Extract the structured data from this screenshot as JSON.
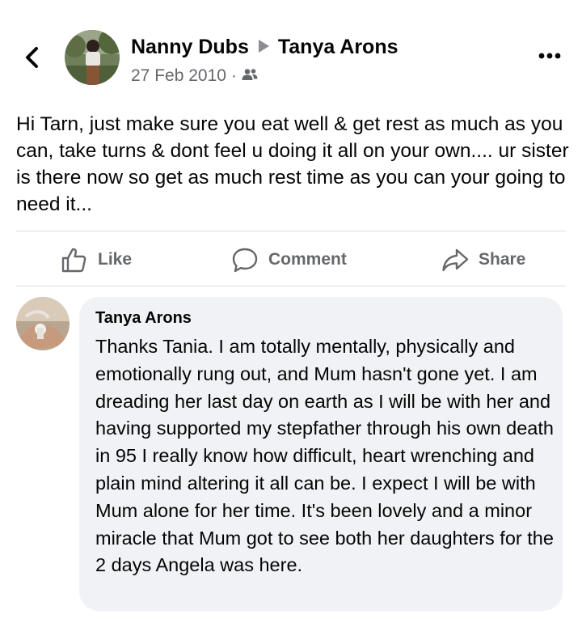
{
  "post": {
    "author": "Nanny Dubs",
    "recipient": "Tanya Arons",
    "date": "27 Feb 2010",
    "separator": "·",
    "audience_icon": "friends-icon",
    "text": "Hi Tarn, just make sure you eat well & get rest as much as you can, take turns & dont feel u doing it all on your own.... ur sister is there now so get as much rest time as you can your going to need it..."
  },
  "actions": {
    "like": "Like",
    "comment": "Comment",
    "share": "Share"
  },
  "comment": {
    "author": "Tanya Arons",
    "text": "Thanks Tania.  I am totally mentally, physically and emotionally rung out, and Mum hasn't gone yet.  I am dreading her last day on earth as I will be with her and having supported my stepfather through his own death in 95 I really know how difficult, heart wrenching and plain mind altering it all can be.  I expect I will be with Mum alone for her time.  It's been lovely and a minor miracle that Mum got to see both her daughters for the 2 days Angela was here."
  },
  "colors": {
    "text_primary": "#050505",
    "text_secondary": "#65676b",
    "bubble_bg": "#f0f2f5",
    "divider": "#dadde1"
  }
}
